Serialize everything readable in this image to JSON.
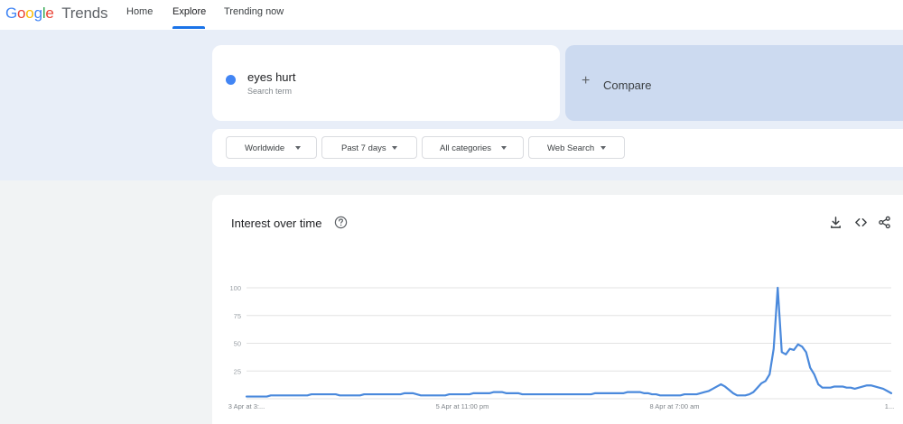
{
  "header": {
    "logo_google": "Google",
    "logo_trends": "Trends",
    "nav": [
      {
        "label": "Home"
      },
      {
        "label": "Explore"
      },
      {
        "label": "Trending now"
      }
    ],
    "active_nav": "Explore"
  },
  "search_term": {
    "name": "eyes hurt",
    "type": "Search term",
    "color": "#4285f4"
  },
  "compare": {
    "label": "Compare",
    "icon": "plus-icon"
  },
  "filters": [
    {
      "label": "Worldwide"
    },
    {
      "label": "Past 7 days"
    },
    {
      "label": "All categories"
    },
    {
      "label": "Web Search"
    }
  ],
  "chart_panel": {
    "title": "Interest over time",
    "icons": [
      "help-icon",
      "download-icon",
      "embed-icon",
      "share-icon"
    ]
  },
  "chart_data": {
    "type": "line",
    "title": "",
    "xlabel": "",
    "ylabel": "",
    "ylim": [
      0,
      100
    ],
    "y_ticks": [
      "100",
      "75",
      "50",
      "25"
    ],
    "x_ticks": [
      "3 Apr at 3:...",
      "5 Apr at 11:00 pm",
      "8 Apr at 7:00 am",
      "1..."
    ],
    "grid": true,
    "series": [
      {
        "color": "#4a89dc",
        "values": [
          2,
          2,
          2,
          2,
          2,
          2,
          3,
          3,
          3,
          3,
          3,
          3,
          3,
          3,
          3,
          3,
          4,
          4,
          4,
          4,
          4,
          4,
          4,
          3,
          3,
          3,
          3,
          3,
          3,
          4,
          4,
          4,
          4,
          4,
          4,
          4,
          4,
          4,
          4,
          5,
          5,
          5,
          4,
          3,
          3,
          3,
          3,
          3,
          3,
          3,
          4,
          4,
          4,
          4,
          4,
          4,
          5,
          5,
          5,
          5,
          5,
          6,
          6,
          6,
          5,
          5,
          5,
          5,
          4,
          4,
          4,
          4,
          4,
          4,
          4,
          4,
          4,
          4,
          4,
          4,
          4,
          4,
          4,
          4,
          4,
          4,
          5,
          5,
          5,
          5,
          5,
          5,
          5,
          5,
          6,
          6,
          6,
          6,
          5,
          5,
          4,
          4,
          3,
          3,
          3,
          3,
          3,
          3,
          4,
          4,
          4,
          4,
          5,
          6,
          7,
          9,
          11,
          13,
          11,
          8,
          5,
          3,
          3,
          3,
          4,
          6,
          10,
          14,
          16,
          22,
          45,
          100,
          42,
          40,
          45,
          44,
          49,
          47,
          42,
          28,
          22,
          13,
          10,
          10,
          10,
          11,
          11,
          11,
          10,
          10,
          9,
          10,
          11,
          12,
          12,
          11,
          10,
          9,
          7,
          5
        ]
      }
    ]
  }
}
